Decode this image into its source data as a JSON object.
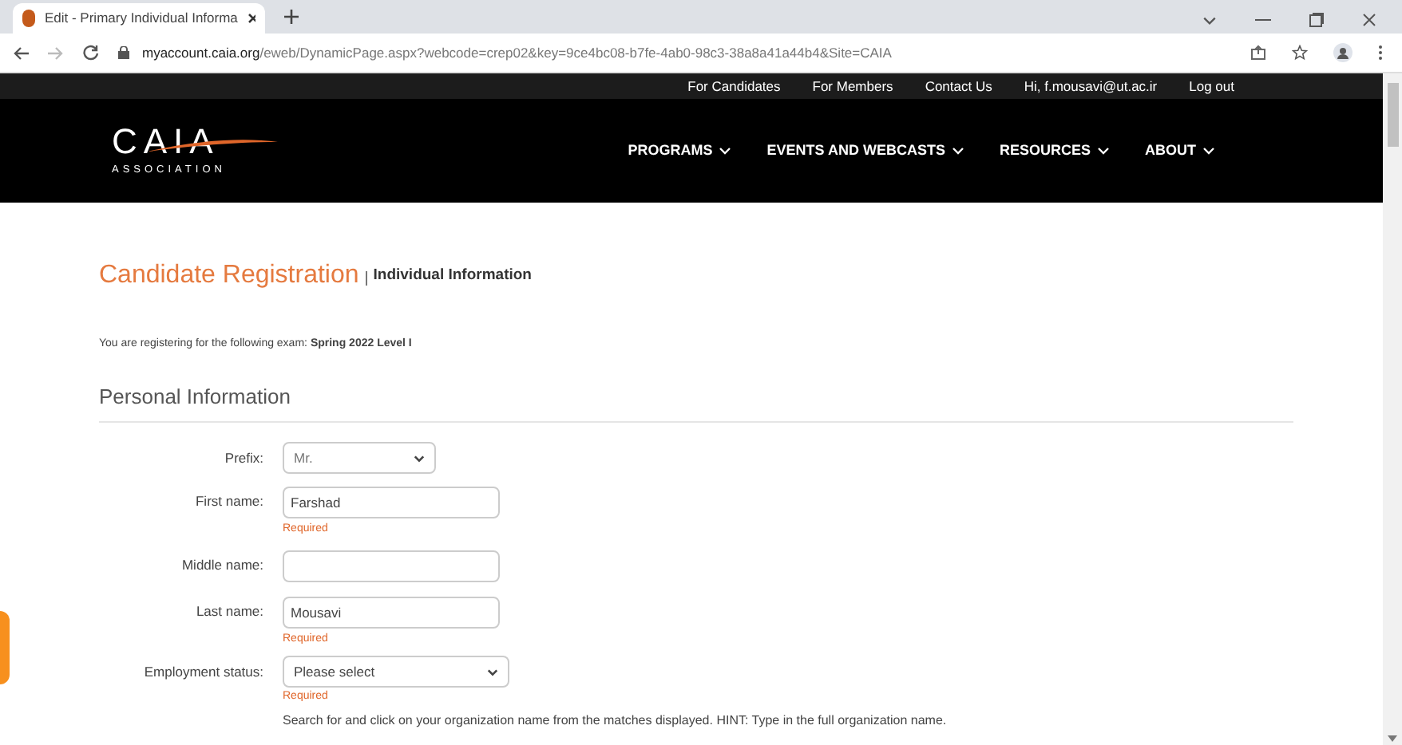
{
  "browser": {
    "tab_title": "Edit - Primary Individual Informa",
    "url_host": "myaccount.caia.org",
    "url_path": "/eweb/DynamicPage.aspx?webcode=crep02&key=9ce4bc08-b7fe-4ab0-98c3-38a8a41a44b4&Site=CAIA"
  },
  "top_links": [
    "For Candidates",
    "For Members",
    "Contact Us",
    "Hi, f.mousavi@ut.ac.ir",
    "Log out"
  ],
  "logo": {
    "main": "CAIA",
    "sub": "ASSOCIATION"
  },
  "main_nav": [
    "PROGRAMS",
    "EVENTS AND WEBCASTS",
    "RESOURCES",
    "ABOUT"
  ],
  "page_title": "Candidate Registration",
  "page_subtitle": "Individual Information",
  "exam_note": "You are registering for the following exam: **Spring 2022 Level I**",
  "section_title": "Personal Information",
  "fields": [
    {
      "kind": "select",
      "label": "Prefix:",
      "value": "Mr."
    },
    {
      "kind": "text",
      "label": "First name:",
      "value": "Farshad",
      "required_note": "Required"
    },
    {
      "kind": "text",
      "label": "Middle name:"
    },
    {
      "kind": "text",
      "label": "Last name:",
      "value": "Mousavi",
      "required_note": "Required"
    },
    {
      "kind": "select-wide",
      "label": "Employment status:",
      "value": "Please select",
      "required_note": "Required"
    }
  ],
  "hint": "Search for and click on your organization name from the matches displayed. HINT: Type in the full organization name."
}
